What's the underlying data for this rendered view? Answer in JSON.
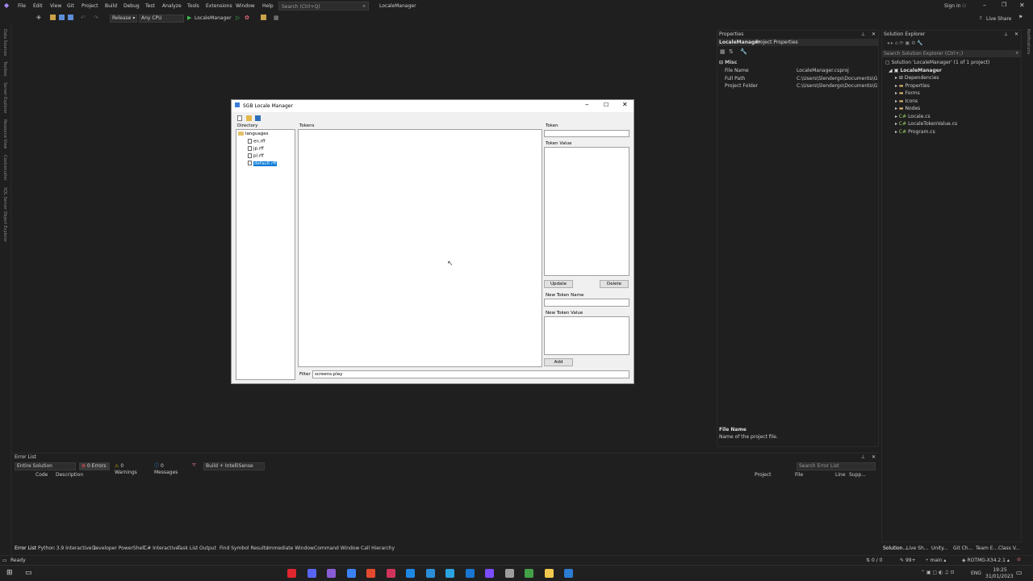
{
  "titlebar": {
    "menus": [
      "File",
      "Edit",
      "View",
      "Git",
      "Project",
      "Build",
      "Debug",
      "Test",
      "Analyze",
      "Tools",
      "Extensions",
      "Window",
      "Help"
    ],
    "search_placeholder": "Search (Ctrl+Q)",
    "solution_name": "LocaleManager",
    "sign_in": "Sign in",
    "live_share": "Live Share"
  },
  "toolbar": {
    "config": "Release",
    "platform": "Any CPU",
    "start_target": "LocaleManager"
  },
  "left_rail": [
    "Data Sources",
    "Toolbox",
    "Server Explorer",
    "Resource View",
    "Cookiecutter",
    "SQL Server Object Explorer"
  ],
  "properties": {
    "header": "Properties",
    "object": "LocaleManager",
    "object_type": "Project Properties",
    "category": "Misc",
    "rows": [
      {
        "name": "File Name",
        "value": "LocaleManager.csproj"
      },
      {
        "name": "Full Path",
        "value": "C:\\Users\\Slendergo\\Documents\\GitHu"
      },
      {
        "name": "Project Folder",
        "value": "C:\\Users\\Slendergo\\Documents\\GitHu"
      }
    ],
    "desc_title": "File Name",
    "desc_text": "Name of the project file."
  },
  "solution_explorer": {
    "header": "Solution Explorer",
    "search_placeholder": "Search Solution Explorer (Ctrl+;)",
    "solution": "Solution 'LocaleManager' (1 of 1 project)",
    "project": "LocaleManager",
    "items": [
      "Dependencies",
      "Properties",
      "Forms",
      "Icons",
      "Nodes",
      "Locale.cs",
      "LocaleTokenValue.cs",
      "Program.cs"
    ]
  },
  "right_rail": [
    "Notifications"
  ],
  "dialog": {
    "title": "SGB Locale Manager",
    "directory_label": "Directory",
    "tokens_label": "Tokens",
    "token_label": "Token",
    "token_value_label": "Token Value",
    "update_button": "Update",
    "delete_button": "Delete",
    "new_token_name_label": "New Token Name",
    "new_token_value_label": "New Token Value",
    "add_button": "Add",
    "filter_label": "Filter",
    "filter_value": "screens.play",
    "tree_root": "languages",
    "tree_items": [
      "en.rff",
      "jp.rff",
      "pl.rff",
      "default.rff"
    ]
  },
  "error_list": {
    "header": "Error List",
    "scope": "Entire Solution",
    "errors": "0 Errors",
    "warnings": "0 Warnings",
    "messages": "0 Messages",
    "build_filter": "Build + IntelliSense",
    "search_placeholder": "Search Error List",
    "columns": [
      "Code",
      "Description",
      "Project",
      "File",
      "Line",
      "Supp..."
    ]
  },
  "bottom_tabs": [
    "Error List",
    "Python 3.9 Interactive 1",
    "Developer PowerShell",
    "C# Interactive",
    "Task List",
    "Output",
    "Find Symbol Results",
    "Immediate Window",
    "Command Window",
    "Call Hierarchy"
  ],
  "right_tabs": [
    "Solution...",
    "Live Sh...",
    "Unity...",
    "Git Ch...",
    "Team E...",
    "Class V..."
  ],
  "statusbar": {
    "status": "Ready",
    "changes": "0 / 0",
    "commits": "99+",
    "branch": "main",
    "repo": "ROTMG-X34.2.1"
  },
  "taskbar": {
    "lang": "ENG",
    "time": "19:25",
    "date": "31/01/2023",
    "icons": [
      {
        "name": "opera-icon",
        "color": "#e0262f"
      },
      {
        "name": "discord-icon",
        "color": "#5865f2"
      },
      {
        "name": "visual-studio-icon",
        "color": "#8a5bd6"
      },
      {
        "name": "chrome-icon",
        "color": "#3b82f6"
      },
      {
        "name": "git-icon",
        "color": "#e64a2e"
      },
      {
        "name": "jetbrains-icon",
        "color": "#d1345b"
      },
      {
        "name": "store-icon",
        "color": "#1e88e5"
      },
      {
        "name": "vscode-icon",
        "color": "#2a8fd8"
      },
      {
        "name": "telegram-icon",
        "color": "#2aa3e0"
      },
      {
        "name": "outlook-icon",
        "color": "#1976d2"
      },
      {
        "name": "github-desktop-icon",
        "color": "#7c4dff"
      },
      {
        "name": "chrome-alt-icon",
        "color": "#9e9e9e"
      },
      {
        "name": "notepad-icon",
        "color": "#43a047"
      },
      {
        "name": "explorer-icon",
        "color": "#f2c94c"
      },
      {
        "name": "app-icon",
        "color": "#2b7cd3"
      }
    ]
  }
}
